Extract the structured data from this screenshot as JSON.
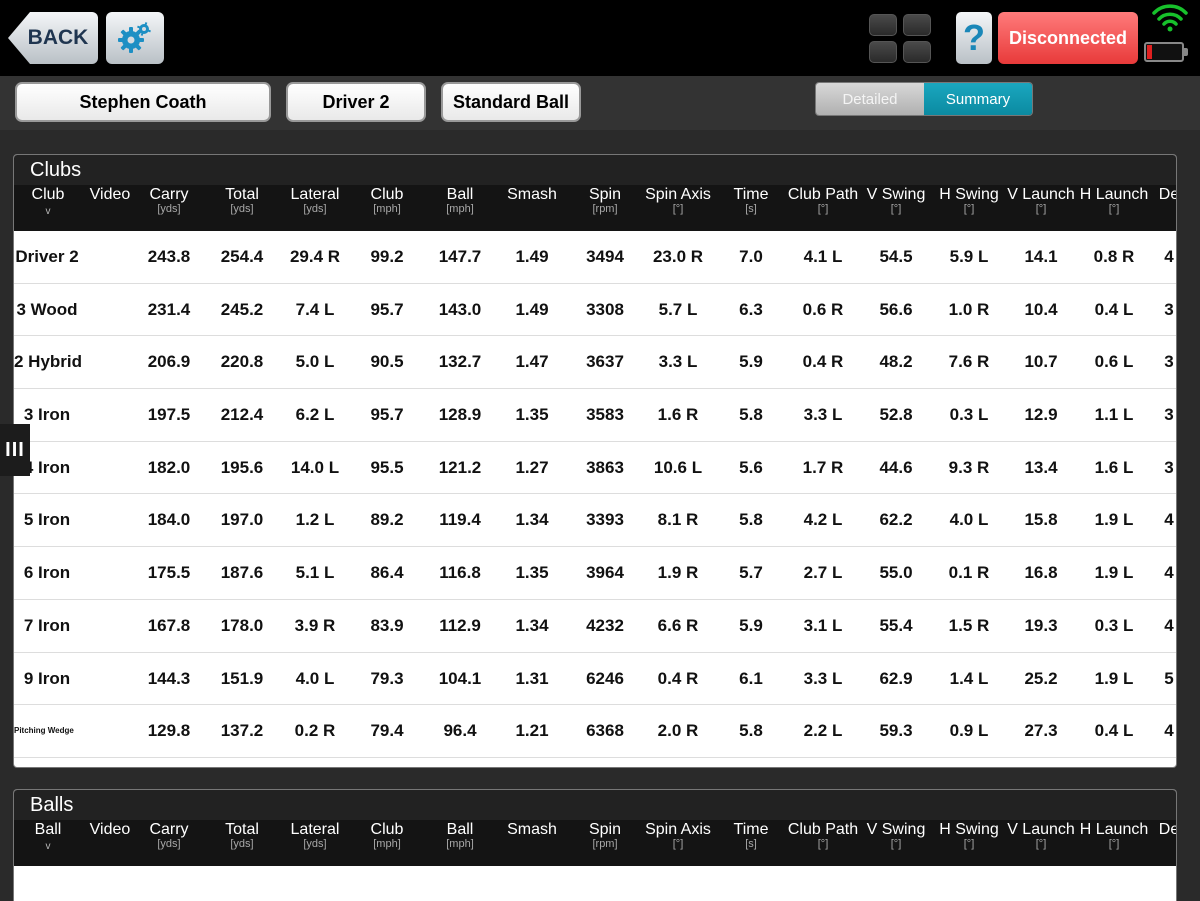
{
  "toolbar": {
    "back_label": "BACK",
    "settings_icon": "gear-icon",
    "layout_icon": "grid-icon",
    "help_label": "?",
    "connection_label": "Disconnected",
    "wifi_icon": "wifi-icon",
    "battery_icon": "battery-icon",
    "battery_level": 0.15,
    "battery_color": "#e02020",
    "connection_color": "#f04848"
  },
  "filters": {
    "player": "Stephen Coath",
    "club": "Driver 2",
    "ball": "Standard Ball"
  },
  "view_toggle": {
    "detailed": "Detailed",
    "summary": "Summary",
    "selected": "Summary",
    "accent": "#0e95ac"
  },
  "side_handle": "III",
  "columns": [
    {
      "label": "Video",
      "unit": ""
    },
    {
      "label": "Carry",
      "unit": "[yds]"
    },
    {
      "label": "Total",
      "unit": "[yds]"
    },
    {
      "label": "Lateral",
      "unit": "[yds]"
    },
    {
      "label": "Club",
      "unit": "[mph]"
    },
    {
      "label": "Ball",
      "unit": "[mph]"
    },
    {
      "label": "Smash",
      "unit": ""
    },
    {
      "label": "Spin",
      "unit": "[rpm]"
    },
    {
      "label": "Spin Axis",
      "unit": "[°]"
    },
    {
      "label": "Time",
      "unit": "[s]"
    },
    {
      "label": "Club Path",
      "unit": "[°]"
    },
    {
      "label": "V Swing",
      "unit": "[°]"
    },
    {
      "label": "H Swing",
      "unit": "[°]"
    },
    {
      "label": "V Launch",
      "unit": "[°]"
    },
    {
      "label": "H Launch",
      "unit": "[°]"
    },
    {
      "label": "De",
      "unit": ""
    }
  ],
  "clubs_section": {
    "title": "Clubs",
    "first_col": "Club",
    "sort_arrow": "v",
    "rows": [
      {
        "name": "Driver 2",
        "values": [
          "",
          "243.8",
          "254.4",
          "29.4 R",
          "99.2",
          "147.7",
          "1.49",
          "3494",
          "23.0 R",
          "7.0",
          "4.1 L",
          "54.5",
          "5.9 L",
          "14.1",
          "0.8 R",
          "4"
        ]
      },
      {
        "name": "3 Wood",
        "values": [
          "",
          "231.4",
          "245.2",
          "7.4 L",
          "95.7",
          "143.0",
          "1.49",
          "3308",
          "5.7 L",
          "6.3",
          "0.6 R",
          "56.6",
          "1.0 R",
          "10.4",
          "0.4 L",
          "3"
        ]
      },
      {
        "name": "2 Hybrid",
        "values": [
          "",
          "206.9",
          "220.8",
          "5.0 L",
          "90.5",
          "132.7",
          "1.47",
          "3637",
          "3.3 L",
          "5.9",
          "0.4 R",
          "48.2",
          "7.6 R",
          "10.7",
          "0.6 L",
          "3"
        ]
      },
      {
        "name": "3 Iron",
        "values": [
          "",
          "197.5",
          "212.4",
          "6.2 L",
          "95.7",
          "128.9",
          "1.35",
          "3583",
          "1.6 R",
          "5.8",
          "3.3 L",
          "52.8",
          "0.3 L",
          "12.9",
          "1.1 L",
          "3"
        ]
      },
      {
        "name": "4 Iron",
        "values": [
          "",
          "182.0",
          "195.6",
          "14.0 L",
          "95.5",
          "121.2",
          "1.27",
          "3863",
          "10.6 L",
          "5.6",
          "1.7 R",
          "44.6",
          "9.3 R",
          "13.4",
          "1.6 L",
          "3"
        ]
      },
      {
        "name": "5 Iron",
        "values": [
          "",
          "184.0",
          "197.0",
          "1.2 L",
          "89.2",
          "119.4",
          "1.34",
          "3393",
          "8.1 R",
          "5.8",
          "4.2 L",
          "62.2",
          "4.0 L",
          "15.8",
          "1.9 L",
          "4"
        ]
      },
      {
        "name": "6 Iron",
        "values": [
          "",
          "175.5",
          "187.6",
          "5.1 L",
          "86.4",
          "116.8",
          "1.35",
          "3964",
          "1.9 R",
          "5.7",
          "2.7 L",
          "55.0",
          "0.1 R",
          "16.8",
          "1.9 L",
          "4"
        ]
      },
      {
        "name": "7 Iron",
        "values": [
          "",
          "167.8",
          "178.0",
          "3.9 R",
          "83.9",
          "112.9",
          "1.34",
          "4232",
          "6.6 R",
          "5.9",
          "3.1 L",
          "55.4",
          "1.5 R",
          "19.3",
          "0.3 L",
          "4"
        ]
      },
      {
        "name": "9 Iron",
        "values": [
          "",
          "144.3",
          "151.9",
          "4.0 L",
          "79.3",
          "104.1",
          "1.31",
          "6246",
          "0.4 R",
          "6.1",
          "3.3 L",
          "62.9",
          "1.4 L",
          "25.2",
          "1.9 L",
          "5"
        ]
      },
      {
        "name": "Pitching Wedge",
        "values": [
          "",
          "129.8",
          "137.2",
          "0.2 R",
          "79.4",
          "96.4",
          "1.21",
          "6368",
          "2.0 R",
          "5.8",
          "2.2 L",
          "59.3",
          "0.9 L",
          "27.3",
          "0.4 L",
          "4"
        ]
      }
    ]
  },
  "balls_section": {
    "title": "Balls",
    "first_col": "Ball",
    "sort_arrow": "v",
    "rows": []
  }
}
